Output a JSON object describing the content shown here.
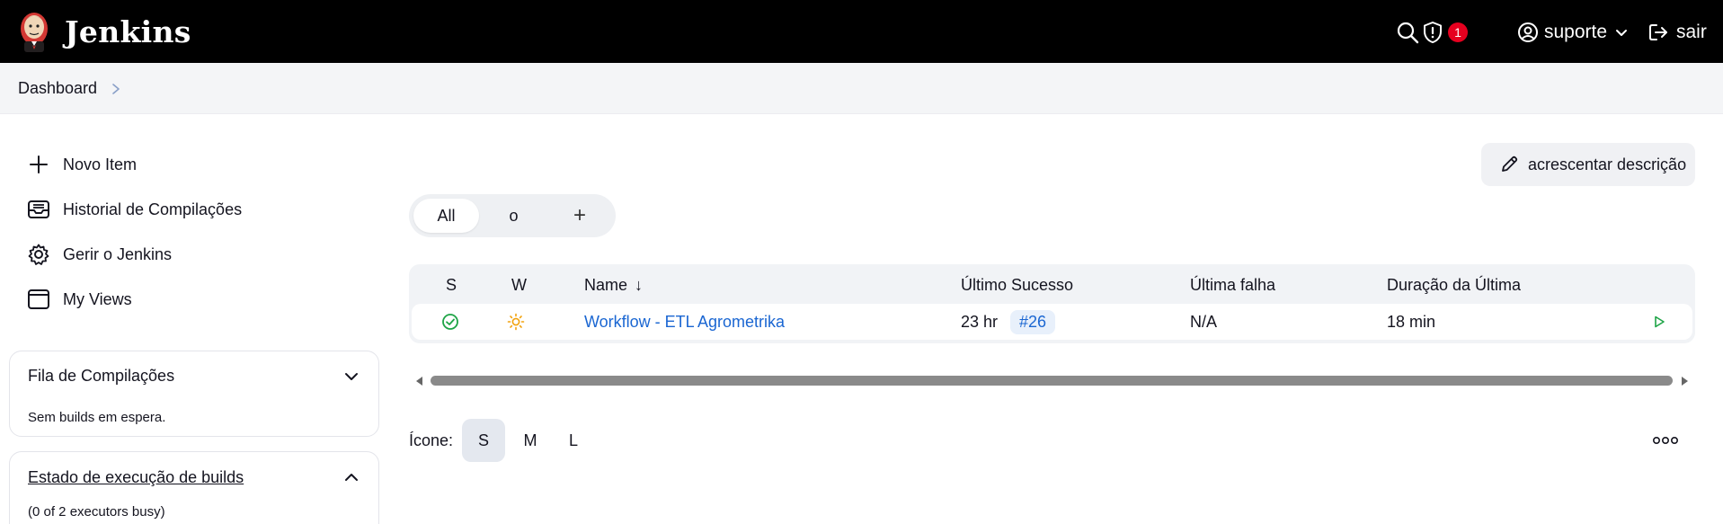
{
  "header": {
    "brand": "Jenkins",
    "security_count": "1",
    "user": "suporte",
    "logout": "sair"
  },
  "breadcrumb": {
    "items": [
      "Dashboard"
    ]
  },
  "sidebar": {
    "tasks": [
      {
        "label": "Novo Item",
        "icon": "plus-icon"
      },
      {
        "label": "Historial de Compilações",
        "icon": "inbox-icon"
      },
      {
        "label": "Gerir o Jenkins",
        "icon": "gear-icon"
      },
      {
        "label": "My Views",
        "icon": "window-icon"
      }
    ],
    "build_queue": {
      "title": "Fila de Compilações",
      "body": "Sem builds em espera."
    },
    "executors": {
      "title": "Estado de execução de builds",
      "body": "(0 of 2 executors busy)"
    }
  },
  "main": {
    "add_description": "acrescentar descrição",
    "tabs": [
      "All",
      "o",
      "+"
    ],
    "table": {
      "headers": {
        "s": "S",
        "w": "W",
        "name": "Name",
        "sort_indicator": "↓",
        "last_success": "Último Sucesso",
        "last_failure": "Última falha",
        "last_duration": "Duração da Última"
      },
      "rows": [
        {
          "name": "Workflow - ETL Agrometrika",
          "last_success_time": "23 hr",
          "last_success_build": "#26",
          "last_failure": "N/A",
          "duration": "18 min",
          "status": "success",
          "weather": "sunny"
        }
      ]
    },
    "icon_size": {
      "label": "Ícone:",
      "options": [
        "S",
        "M",
        "L"
      ],
      "selected": "S"
    }
  },
  "colors": {
    "header_bg": "#000000",
    "link": "#1a66d2",
    "success": "#1ea446",
    "weather": "#f2a20c",
    "badge": "#e6001f"
  }
}
